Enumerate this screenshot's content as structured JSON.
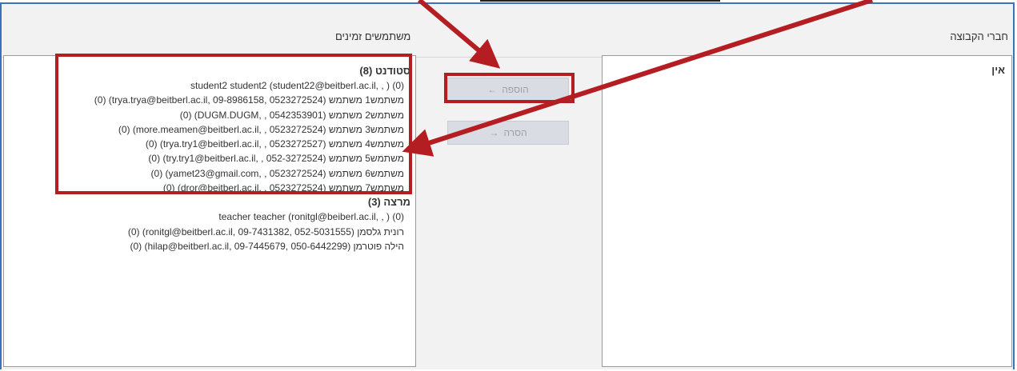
{
  "header": {
    "members_label": "חברי הקבוצה",
    "potential_label": "משתמשים זמינים"
  },
  "members": {
    "empty_label": "אין"
  },
  "buttons": {
    "add_label": "הוספה",
    "add_arrow": "←",
    "remove_label": "הסרה",
    "remove_arrow": "→"
  },
  "potential": {
    "groups": [
      {
        "title": "סטודנט (8)",
        "options": [
          "student2 student2 (student22@beitberl.ac.il, , ) (0)",
          "משתמש1 משתמש (trya.trya@beitberl.ac.il, 09-8986158, 0523272524) (0)",
          "משתמש2 משתמש (DUGM.DUGM, , 0542353901) (0)",
          "משתמש3 משתמש (more.meamen@beitberl.ac.il, , 0523272524) (0)",
          "משתמש4 משתמש (trya.try1@beitberl.ac.il, , 0523272527) (0)",
          "משתמש5 משתמש (try.try1@beitberl.ac.il, , 052-3272524) (0)",
          "משתמש6 משתמש (yamet23@gmail.com, , 0523272524) (0)",
          "משתמש7 משתמש (dror@beitberl.ac.il, , 0523272524) (0)"
        ]
      },
      {
        "title": "מרצה (3)",
        "options": [
          "teacher teacher (ronitgl@beiberl.ac.il, , ) (0)",
          "רונית גלסמן (ronitgl@beitberl.ac.il, 09-7431382, 052-5031555) (0)",
          "הילה פוטרמן (hilap@beitberl.ac.il, 09-7445679, 050-6442299) (0)"
        ]
      }
    ]
  },
  "annotation": {
    "color": "#b41e22"
  }
}
